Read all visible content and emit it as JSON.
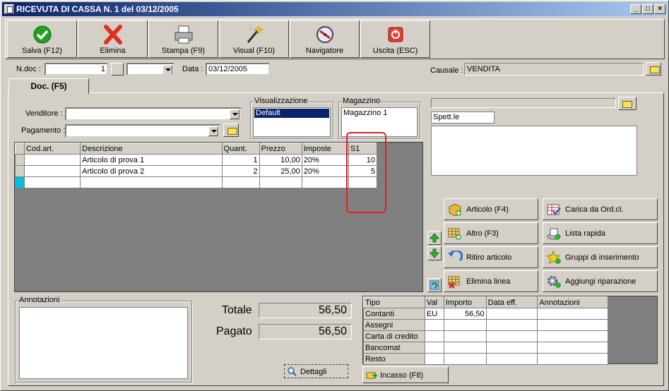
{
  "window": {
    "title": "RICEVUTA DI CASSA N. 1  del 03/12/2005",
    "min_label": "_",
    "max_label": "□",
    "close_label": "×"
  },
  "toolbar": [
    {
      "label": "Salva (F12)",
      "icon": "check-icon"
    },
    {
      "label": "Elimina",
      "icon": "delete-x-icon"
    },
    {
      "label": "Stampa (F9)",
      "icon": "printer-icon"
    },
    {
      "label": "Visual (F10)",
      "icon": "magic-wand-icon"
    },
    {
      "label": "Navigatore",
      "icon": "compass-icon"
    },
    {
      "label": "Uscita (ESC)",
      "icon": "power-icon"
    }
  ],
  "header": {
    "ndoc_label": "N.doc :",
    "ndoc_value": "1",
    "series_value": "",
    "data_label": "Data :",
    "data_value": "03/12/2005",
    "causale_label": "Causale :",
    "causale_value": "VENDITA"
  },
  "tab": {
    "label": "Doc. (F5)"
  },
  "form": {
    "venditore_label": "Venditore :",
    "venditore_value": "",
    "pagamento_label": "Pagamento :",
    "pagamento_value": ""
  },
  "visualizzazione": {
    "title": "Visualizzazione",
    "items": [
      "Default"
    ]
  },
  "magazzino": {
    "title": "Magazzino",
    "value": "Magazzino 1"
  },
  "customer": {
    "code_value": "",
    "name_value": "Spett.le",
    "address_value": ""
  },
  "lines_table": {
    "columns": [
      "Cod.art.",
      "Descrizione",
      "Quant.",
      "Prezzo",
      "Imposte",
      "S1"
    ],
    "rows": [
      [
        "",
        "Articolo di prova 1",
        "1",
        "10,00",
        "20%",
        "10"
      ],
      [
        "",
        "Articolo di prova 2",
        "2",
        "25,00",
        "20%",
        "5"
      ]
    ]
  },
  "actions": [
    {
      "label": "Articolo (F4)",
      "icon": "box-add-icon"
    },
    {
      "label": "Carica da Ord.cl.",
      "icon": "load-order-icon"
    },
    {
      "label": "Altro (F3)",
      "icon": "grid-add-icon"
    },
    {
      "label": "Lista rapida",
      "icon": "quick-list-icon"
    },
    {
      "label": "Ritiro articolo",
      "icon": "return-arrow-icon"
    },
    {
      "label": "Gruppi di inserimento",
      "icon": "star-add-icon"
    },
    {
      "label": "Elimina linea",
      "icon": "delete-line-icon"
    },
    {
      "label": "Aggiungi riparazione",
      "icon": "gears-icon"
    }
  ],
  "annotazioni": {
    "title": "Annotazioni",
    "value": ""
  },
  "totals": {
    "totale_label": "Totale",
    "totale_value": "56,50",
    "pagato_label": "Pagato",
    "pagato_value": "56,50",
    "dettagli_label": "Dettagli"
  },
  "payments_table": {
    "columns": [
      "Tipo",
      "Val",
      "Importo",
      "Data eff.",
      "Annotazioni"
    ],
    "rows": [
      [
        "Contanti",
        "EU",
        "56,50",
        "",
        ""
      ],
      [
        "Assegni",
        "",
        "",
        "",
        ""
      ],
      [
        "Carta di credito",
        "",
        "",
        "",
        ""
      ],
      [
        "Bancomat",
        "",
        "",
        "",
        ""
      ],
      [
        "Resto",
        "",
        "",
        "",
        ""
      ]
    ]
  },
  "incasso": {
    "label": "Incasso (F8)"
  },
  "colors": {
    "title_start": "#0a246a",
    "title_end": "#a6caf0",
    "highlight": "#e02020",
    "selection": "#0a246a"
  }
}
